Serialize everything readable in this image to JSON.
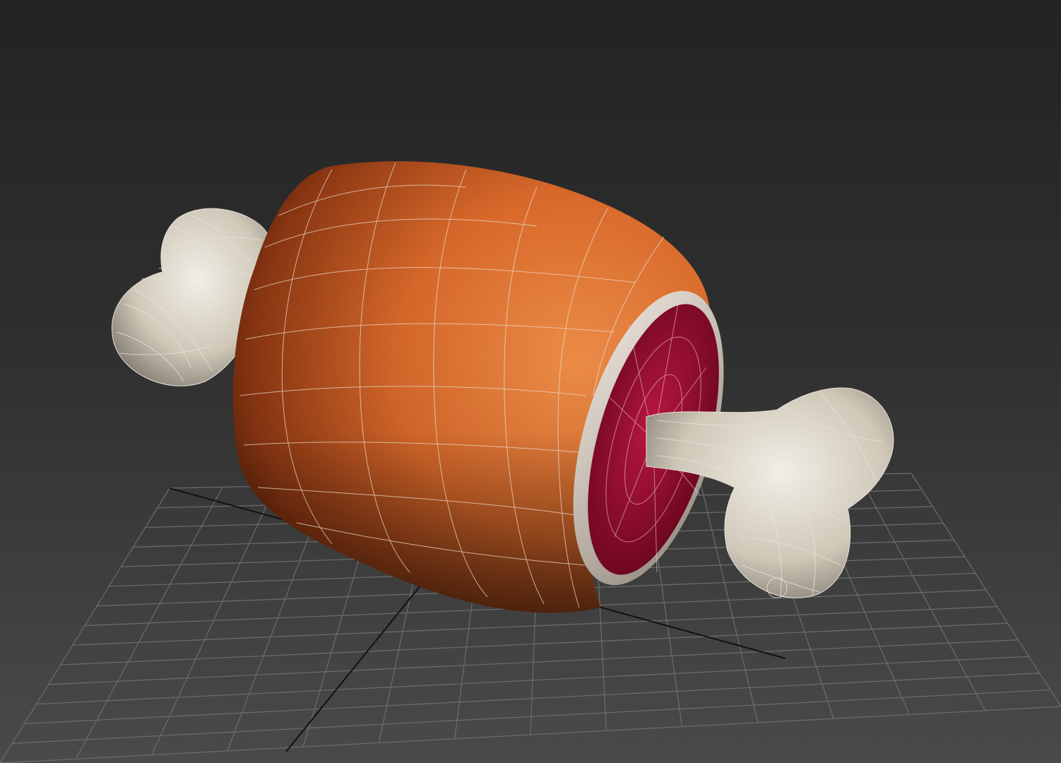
{
  "viewport": {
    "mode": "perspective",
    "shading": "smooth-shaded-with-wireframe-edges",
    "background_top": "#232323",
    "background_bottom": "#4a4a4a"
  },
  "scene": {
    "object": "cartoon-meat-on-bone",
    "parts": [
      "meat-body",
      "cut-face",
      "bone-left",
      "bone-right"
    ]
  },
  "colors": {
    "meat": "#d9692a",
    "meat_shadow": "#3a1404",
    "cut_face": "#8e0a2c",
    "fat_ring": "#d8ccbf",
    "bone": "#cfc8b8",
    "wire": "#e8e2da",
    "grid": "#6d6d6d",
    "grid_axis": "#111111"
  }
}
